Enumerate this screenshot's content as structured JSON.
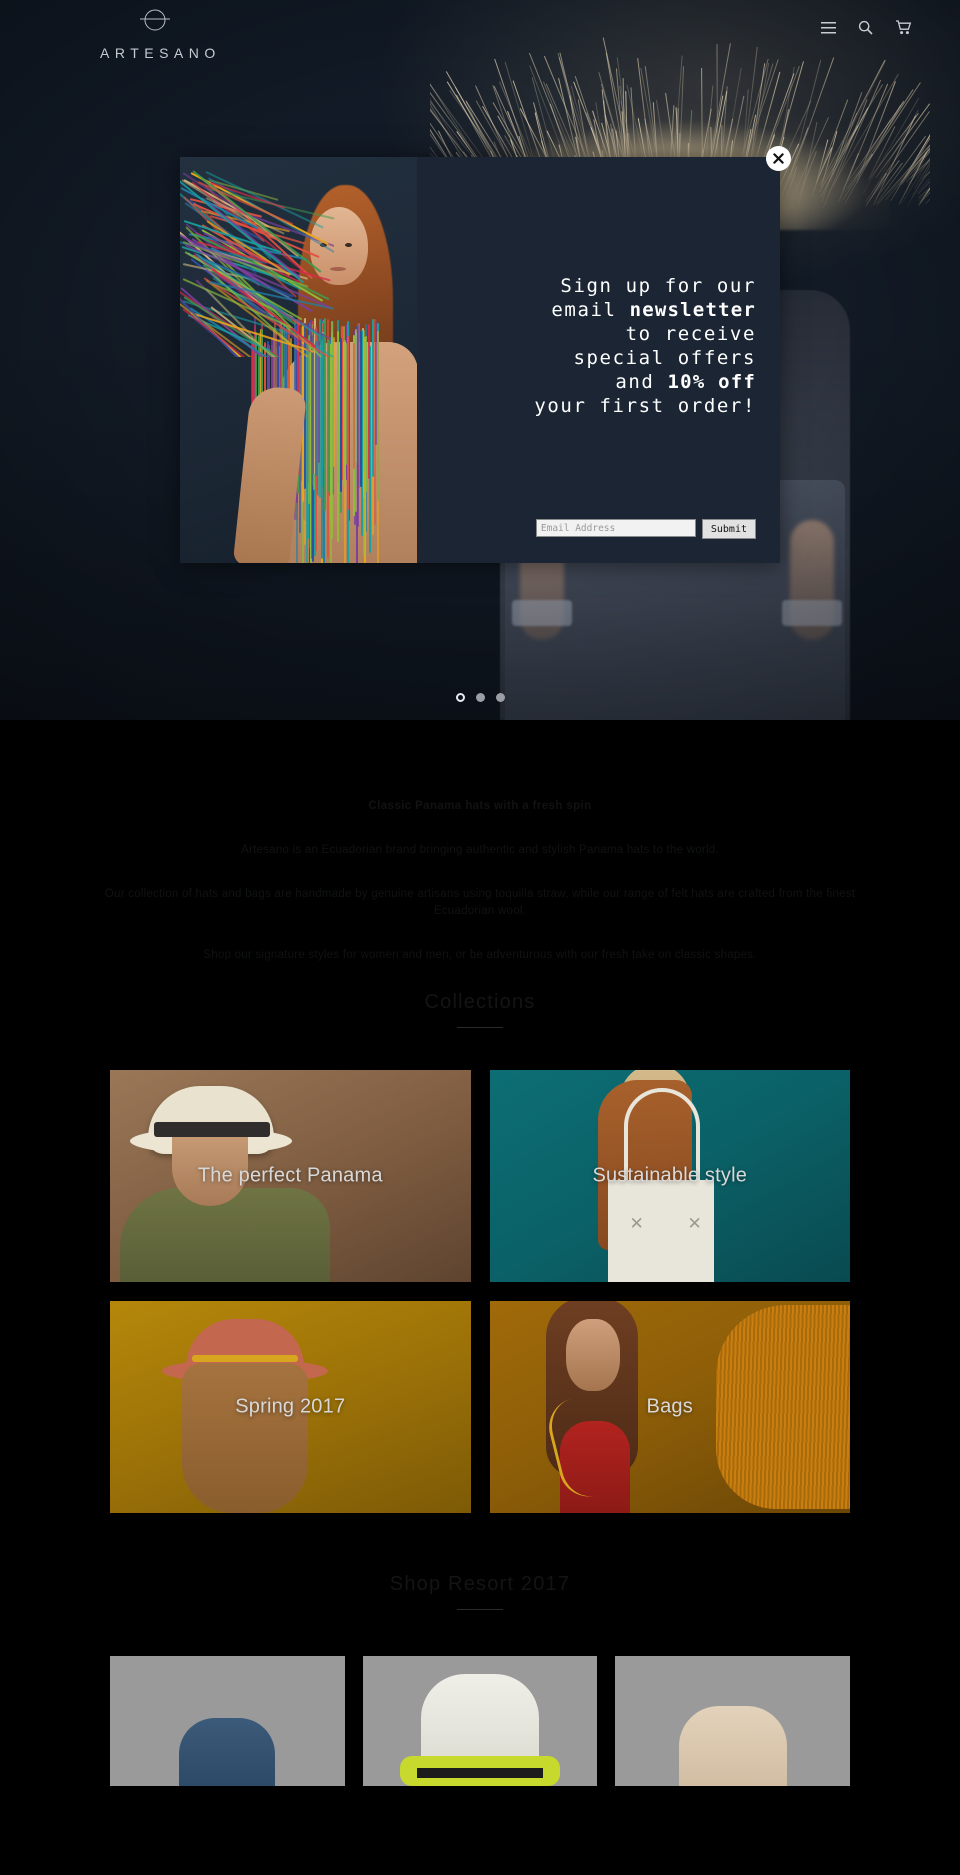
{
  "header": {
    "brand_name": "ARTESANO",
    "brand_mark": "circle-line-logo",
    "icons": [
      {
        "name": "menu-icon",
        "label": "Menu"
      },
      {
        "name": "search-icon",
        "label": "Search"
      },
      {
        "name": "cart-icon",
        "label": "Cart"
      }
    ]
  },
  "hero": {
    "dots": [
      {
        "active": true
      },
      {
        "active": false
      },
      {
        "active": false
      }
    ]
  },
  "modal": {
    "close_label": "✕",
    "close_icon": "close-icon",
    "heading_line1": "Sign up for our",
    "heading_line2_plain": "email ",
    "heading_line2_bold": "newsletter",
    "heading_line3": "to receive",
    "heading_line4": "special offers",
    "heading_line5_plain": "and ",
    "heading_line5_bold": "10% off",
    "heading_line6": "your first order!",
    "email_placeholder": "Email Address",
    "email_value": "",
    "submit_label": "Submit"
  },
  "intro": {
    "lead": "Classic Panama hats with a fresh spin",
    "p1": "Artesano is an Ecuadorian brand bringing authentic and stylish Panama hats to the world.",
    "p2": "Our collection of hats and bags are handmade by genuine artisans using toquilla straw, while our range of felt hats are crafted from the finest Ecuadorian wool.",
    "p3": "Shop our signature styles for women and men, or be adventurous with our fresh take on classic shapes."
  },
  "collections_section": {
    "title": "Collections",
    "tiles": [
      {
        "label": "The perfect Panama"
      },
      {
        "label": "Sustainable style"
      },
      {
        "label": "Spring 2017"
      },
      {
        "label": "Bags"
      }
    ]
  },
  "resort_section": {
    "title": "Shop Resort 2017",
    "products": [
      {
        "name": "product-1"
      },
      {
        "name": "product-2"
      },
      {
        "name": "product-3"
      }
    ]
  },
  "colors": {
    "hero_bg": "#131a24",
    "modal_bg": "#1b2533",
    "page_bg": "#000000",
    "tile_label": "#d8d8d8",
    "brand_text": "#c6cbd2"
  }
}
